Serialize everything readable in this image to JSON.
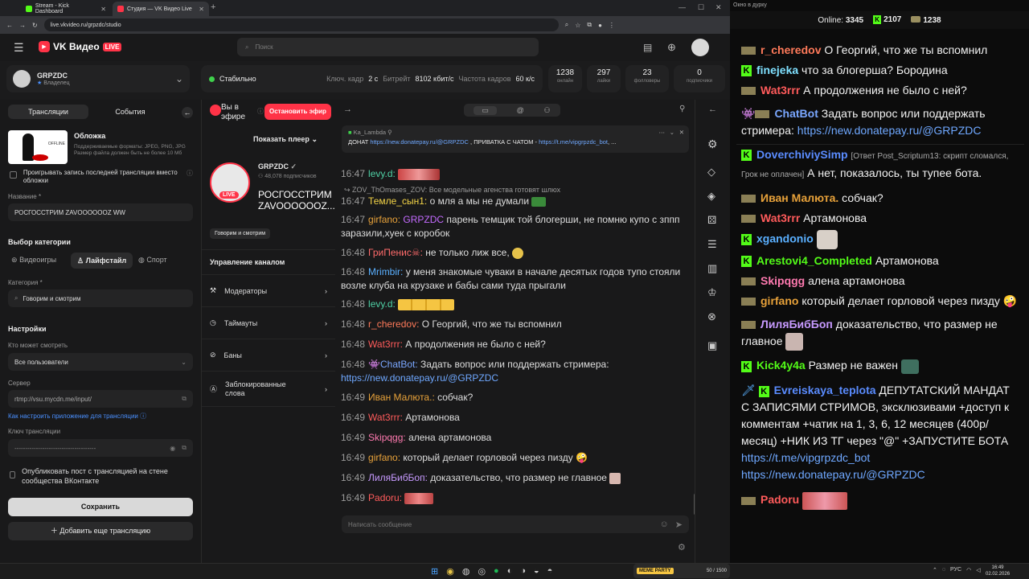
{
  "browser": {
    "tabs": [
      {
        "label": "Stream - Kick Dashboard",
        "color": "#53fc18"
      },
      {
        "label": "Студия — VK Видео Live",
        "color": "#ff3347"
      }
    ],
    "url": "live.vkvideo.ru/grpzdc/studio"
  },
  "header": {
    "brand": "VK Видео",
    "brand_badge": "LIVE",
    "search_placeholder": "Поиск"
  },
  "channel": {
    "name": "GRPZDC",
    "role": "Владелец"
  },
  "status": {
    "state": "Стабильно",
    "keyframe_label": "Ключ. кадр",
    "keyframe": "2 с",
    "bitrate_label": "Битрейт",
    "bitrate": "8102 кбит/с",
    "fps_label": "Частота кадров",
    "fps": "60 к/с"
  },
  "stats": [
    {
      "value": "1238",
      "label": "онлайн"
    },
    {
      "value": "297",
      "label": "лайки"
    },
    {
      "value": "23",
      "label": "фолловеры"
    },
    {
      "value": "0",
      "label": "подписчики"
    }
  ],
  "left": {
    "tab_streams": "Трансляции",
    "tab_events": "События",
    "cover_title": "Обложка",
    "cover_hint": "Поддерживаемые форматы: JPEG, PNG, JPG Размер файла должен быть не более 10 Мб",
    "cover_thumb_label": "OFFLINE",
    "replay_label": "Проигрывать запись последней трансляции вместо обложки",
    "name_label": "Название *",
    "name_value": "РОСГОССТРИМ ZAVOOOOOOZ WW",
    "category_section": "Выбор категории",
    "cat_games": "Видеоигры",
    "cat_life": "Лайфстайл",
    "cat_sport": "Спорт",
    "category_label": "Категория *",
    "category_value": "Говорим и смотрим",
    "settings_title": "Настройки",
    "who_label": "Кто может смотреть",
    "who_value": "Все пользователи",
    "server_label": "Сервер",
    "server_value": "rtmp://vsu.mycdn.me/input/",
    "howto_link": "Как настроить приложение для трансляции",
    "key_label": "Ключ трансляции",
    "key_value": "--------------------------------------",
    "publish_label": "Опубликовать пост с трансляцией на стене сообщества ВКонтакте",
    "save_button": "Сохранить",
    "add_button": "Добавить еще трансляцию"
  },
  "middle": {
    "on_air": "Вы в эфире",
    "stop_button": "Остановить эфир",
    "show_player": "Показать плеер",
    "channel_name": "GRPZDC",
    "subscribers": "48,078 подписчиков",
    "stream_title": "РОСГОССТРИМ ZAVOOOOOOZ...",
    "category_tag": "Говорим и смотрим",
    "live_badge": "LIVE",
    "manage_title": "Управление каналом",
    "menu": [
      "Модераторы",
      "Таймауты",
      "Баны",
      "Заблокированные слова"
    ]
  },
  "chat": {
    "pinned_author": "Ka_Lambda",
    "pinned_prefix": "ДОНАТ",
    "pinned_link1": "https://new.donatepay.ru/@GRPZDC",
    "pinned_mid": ", ПРИВАТКА С ЧАТОМ -",
    "pinned_link2": "https://t.me/vipgrpzdc_bot",
    "pinned_suffix": ", ...",
    "reply_note": "ZOV_ThOmases_ZOV: Все модельные агенства готовят шлюх",
    "input_placeholder": "Написать сообщение",
    "messages": [
      {
        "time": "16:47",
        "nick": "levy.d:",
        "color": "#4fd1a5",
        "text": ""
      },
      {
        "time": "16:47",
        "nick": "Темле_сын1:",
        "color": "#f5d547",
        "text": "о мля а мы не думали"
      },
      {
        "time": "16:47",
        "nick": "girfano:",
        "color": "#e8a23a",
        "mention": "GRPZDC",
        "text": "парень темщик той блогерши, не помню купо с зппп заразили,хуек с коробок"
      },
      {
        "time": "16:48",
        "nick": "ГриПенис☠:",
        "color": "#ff6b6b",
        "text": "не только лиж все,"
      },
      {
        "time": "16:48",
        "nick": "Mrimbir:",
        "color": "#5ab0ff",
        "text": "у меня знакомые чуваки в начале десятых годов тупо стояли возле клуба на крузаке и бабы сами туда прыгали"
      },
      {
        "time": "16:48",
        "nick": "levy.d:",
        "color": "#4fd1a5",
        "text": ""
      },
      {
        "time": "16:48",
        "nick": "r_cheredov:",
        "color": "#ff7a5a",
        "text": "О Георгий, что же ты вспомнил"
      },
      {
        "time": "16:48",
        "nick": "Wat3rrr:",
        "color": "#ff5b5b",
        "text": "А продолжения не было с ней?"
      },
      {
        "time": "16:48",
        "nick": "ChatBot:",
        "color": "#7aa7ff",
        "text": "Задать вопрос или поддержать стримера:",
        "link": "https://new.donatepay.ru/@GRPZDC"
      },
      {
        "time": "16:49",
        "nick": "Иван Малюта.:",
        "color": "#e8a23a",
        "text": "собчак?"
      },
      {
        "time": "16:49",
        "nick": "Wat3rrr:",
        "color": "#ff5b5b",
        "text": "Артамонова"
      },
      {
        "time": "16:49",
        "nick": "Skipqgg:",
        "color": "#ff7ab0",
        "text": "алена артамонова"
      },
      {
        "time": "16:49",
        "nick": "girfano:",
        "color": "#e8a23a",
        "text": "который делает горловой через пизду"
      },
      {
        "time": "16:49",
        "nick": "ЛиляБибБоп:",
        "color": "#c79aff",
        "text": "доказательство, что размер не главное"
      },
      {
        "time": "16:49",
        "nick": "Padoru:",
        "color": "#ff5b5b",
        "text": ""
      }
    ]
  },
  "kick": {
    "window_title": "Окно в дурку",
    "online_label": "Online:",
    "online": "3345",
    "kick_count": "2107",
    "vk_count": "1238",
    "messages": [
      {
        "badge": "vk",
        "nick": "r_cheredov",
        "color": "#ff7a5a",
        "text": "О Георгий, что же ты вспомнил"
      },
      {
        "badge": "kick",
        "nick": "finejeka",
        "color": "#7fe0ff",
        "text": "что за блогерша? Бородина"
      },
      {
        "badge": "vk",
        "nick": "Wat3rrr",
        "color": "#ff5b5b",
        "text": "А продолжения не было с ней?"
      },
      {
        "badge": "bot",
        "nick": "ChatBot",
        "color": "#7aa7ff",
        "text": "Задать вопрос или поддержать стримера:",
        "link": "https://new.donatepay.ru/@GRPZDC"
      },
      {
        "badge": "kick",
        "nick": "DoverchiviySimp",
        "color": "#5a8cff",
        "reply": "[Ответ Post_Scriptum13: скрипт сломался, Грок не оплачен]",
        "text": "А нет, показалось, ты тупее бота."
      },
      {
        "badge": "vk",
        "nick": "Иван Малюта.",
        "color": "#e8a23a",
        "text": "собчак?"
      },
      {
        "badge": "vk",
        "nick": "Wat3rrr",
        "color": "#ff5b5b",
        "text": "Артамонова"
      },
      {
        "badge": "kick",
        "nick": "xgandonio",
        "color": "#5ab0ff",
        "text": ""
      },
      {
        "badge": "kick",
        "nick": "Arestovi4_Completed",
        "color": "#53fc18",
        "text": "Артамонова"
      },
      {
        "badge": "vk",
        "nick": "Skipqgg",
        "color": "#ff7ab0",
        "text": "алена артамонова"
      },
      {
        "badge": "vk",
        "nick": "girfano",
        "color": "#e8a23a",
        "text": "который делает горловой через пизду"
      },
      {
        "badge": "vk",
        "nick": "ЛиляБибБоп",
        "color": "#c79aff",
        "text": "доказательство, что размер не главное"
      },
      {
        "badge": "kick",
        "nick": "Kick4y4a",
        "color": "#53fc18",
        "text": "Размер не важен"
      },
      {
        "badge": "kick",
        "nick": "Evreiskaya_teplota",
        "color": "#5a8cff",
        "text": "ДЕПУТАТСКИЙ МАНДАТ С ЗАПИСЯМИ СТРИМОВ, эксклюзивами +доступ к комментам +чатик на 1, 3, 6, 12 месяцев (400р/месяц) +НИК ИЗ ТГ через \"@\" +ЗАПУСТИТЕ БОТА",
        "link": "https://t.me/vipgrpzdc_bot",
        "link2": "https://new.donatepay.ru/@GRPZDC"
      },
      {
        "badge": "vk",
        "nick": "Padoru",
        "color": "#ff5b5b",
        "text": ""
      }
    ]
  },
  "taskbar": {
    "widget": "MEME PARTY",
    "widget_count": "50 / 1500",
    "lang": "РУС",
    "time": "16:49",
    "date": "02.02.2026"
  }
}
